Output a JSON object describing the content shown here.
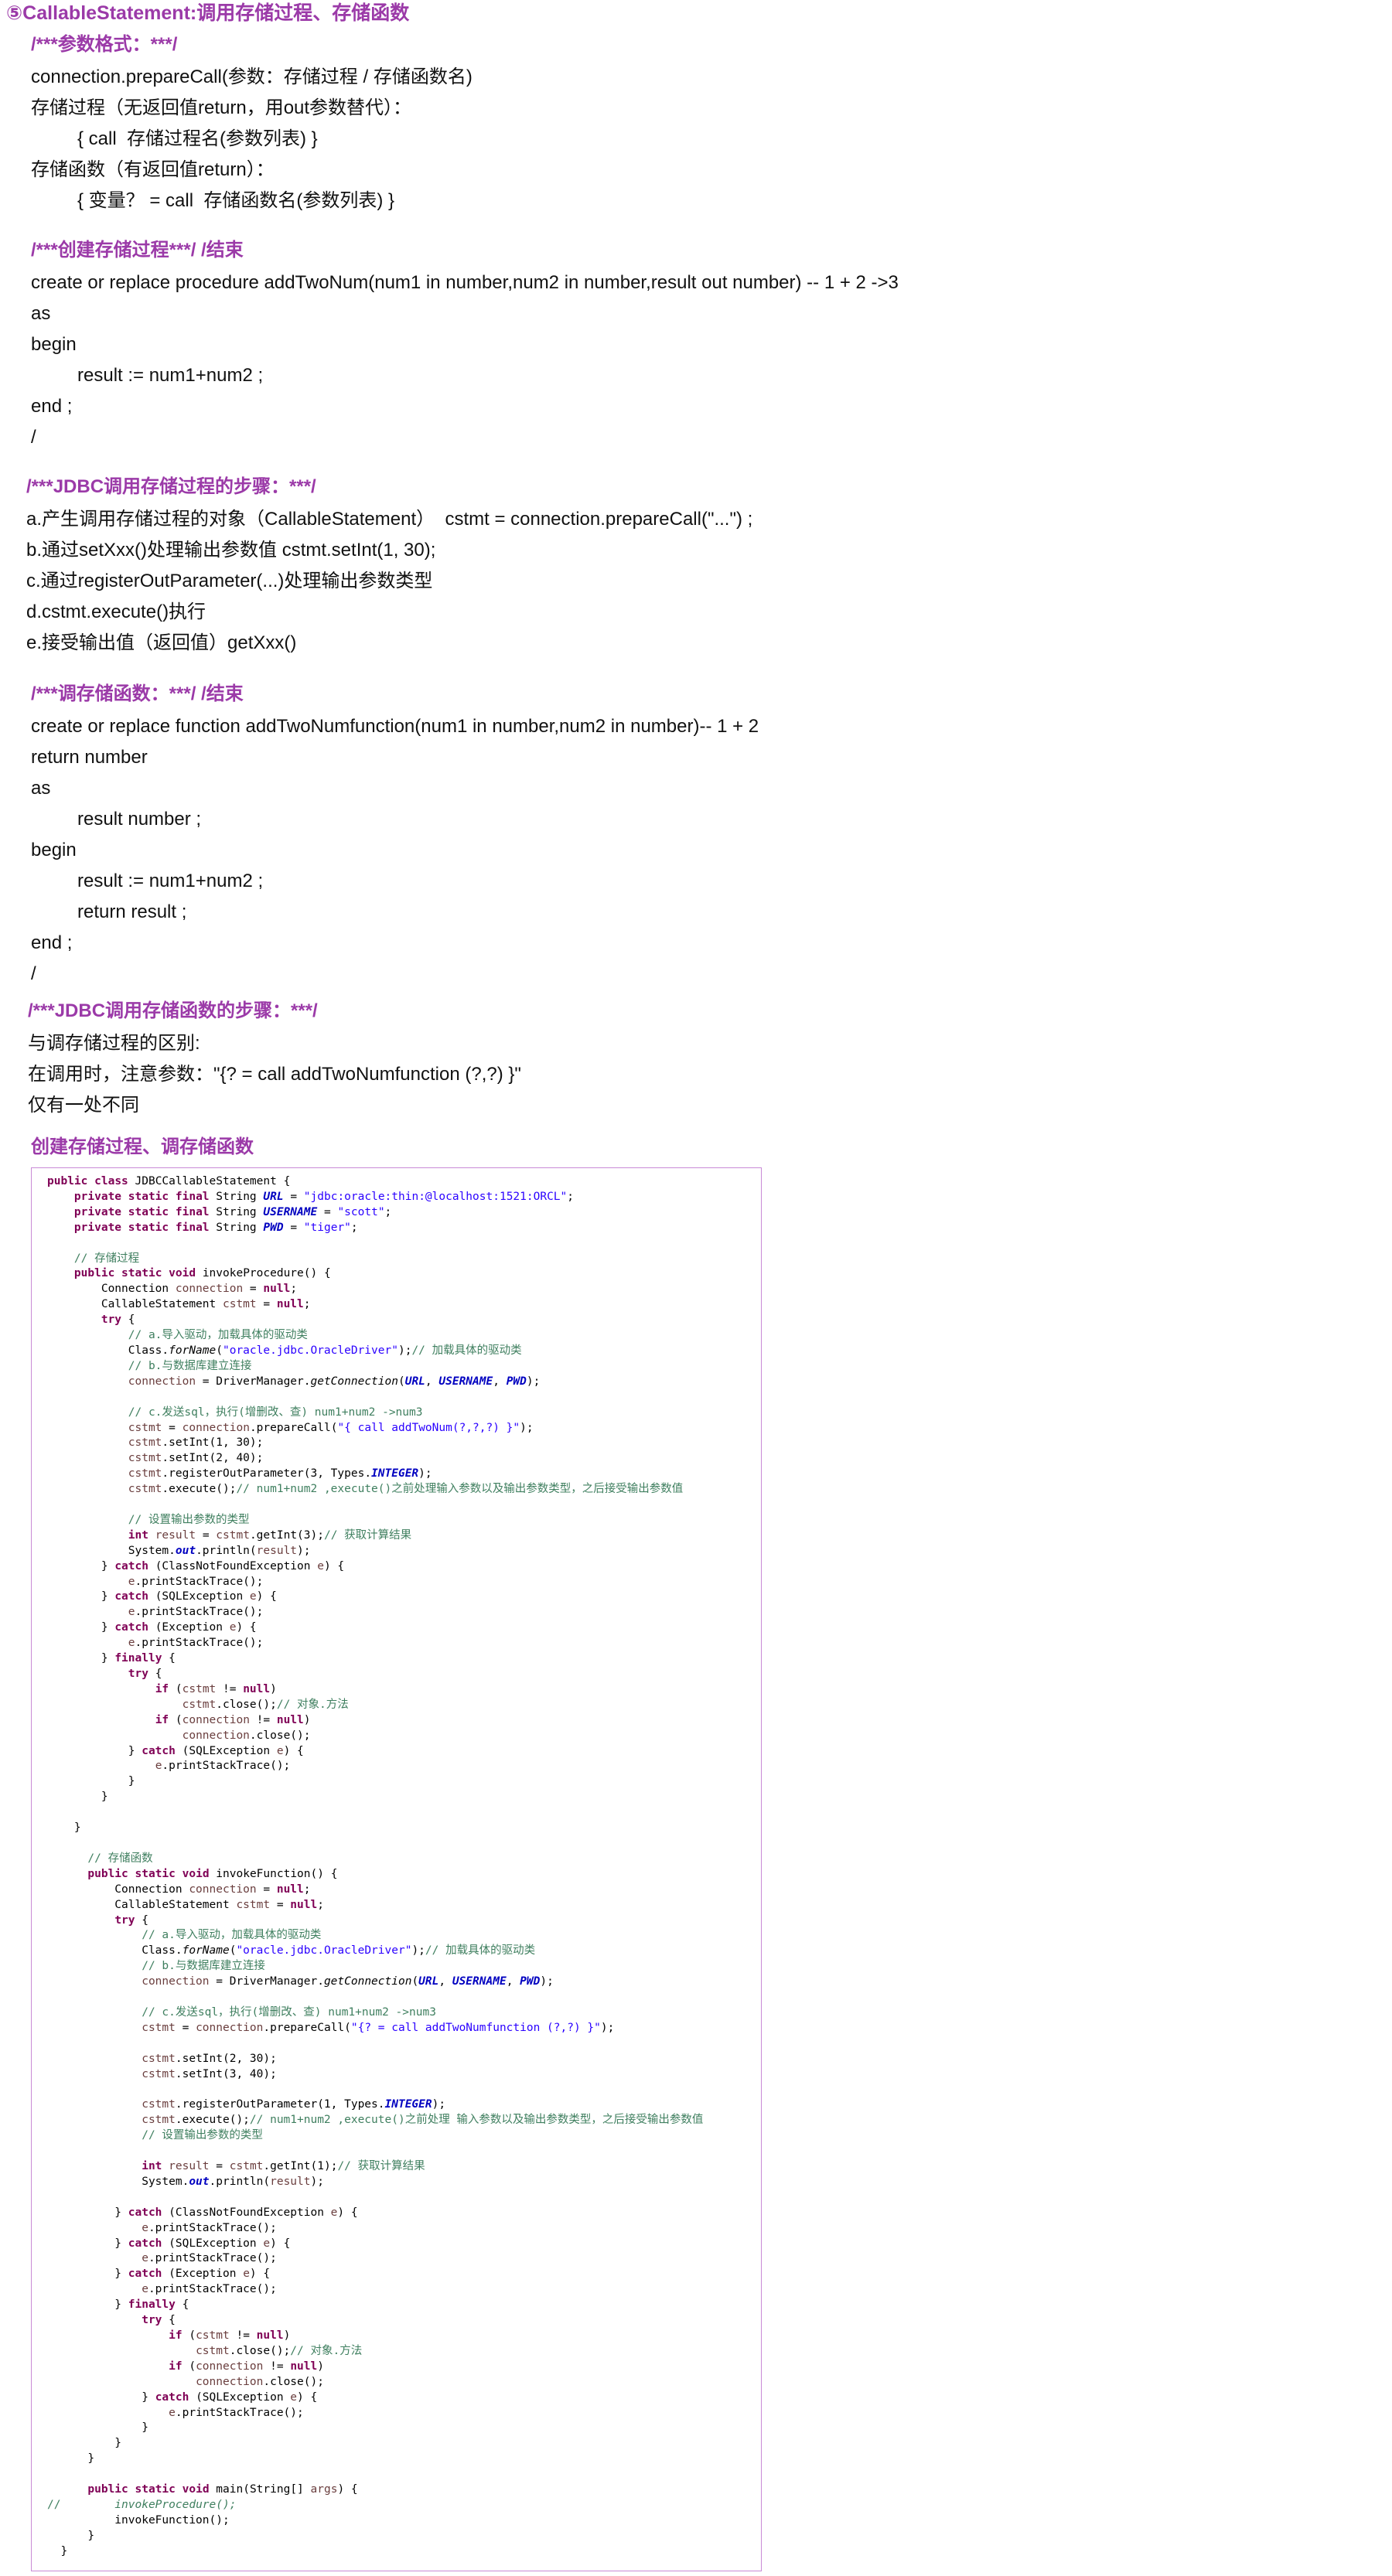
{
  "heading": "⑤CallableStatement:调用存储过程、存储函数",
  "format_section": {
    "title": "/***参数格式：***/",
    "lines": [
      {
        "text": "connection.prepareCall(参数：存储过程 / 存储函数名)",
        "indent": 0
      },
      {
        "text": "存储过程（无返回值return，用out参数替代）：",
        "indent": 0
      },
      {
        "text": "{ call  存储过程名(参数列表) }",
        "indent": 1
      },
      {
        "text": "存储函数（有返回值return）：",
        "indent": 0
      },
      {
        "text": "{ 变量？ = call  存储函数名(参数列表) }",
        "indent": 1
      }
    ]
  },
  "create_proc_section": {
    "title": "/***创建存储过程***/      /结束",
    "lines": [
      {
        "text": "create or replace procedure addTwoNum(num1 in number,num2 in number,result out number) -- 1 + 2 ->3",
        "indent": 0
      },
      {
        "text": "as",
        "indent": 0
      },
      {
        "text": "begin",
        "indent": 0
      },
      {
        "text": "result := num1+num2 ;",
        "indent": 1
      },
      {
        "text": "end ;",
        "indent": 0
      },
      {
        "text": "/",
        "indent": 0
      }
    ]
  },
  "jdbc_proc_section": {
    "title": "/***JDBC调用存储过程的步骤：***/",
    "lines": [
      {
        "text": "a.产生调用存储过程的对象（CallableStatement）  cstmt = connection.prepareCall(\"...\") ;",
        "indent": 0
      },
      {
        "text": "b.通过setXxx()处理输出参数值 cstmt.setInt(1, 30);",
        "indent": 0
      },
      {
        "text": "c.通过registerOutParameter(...)处理输出参数类型",
        "indent": 0
      },
      {
        "text": "d.cstmt.execute()执行",
        "indent": 0
      },
      {
        "text": "e.接受输出值（返回值）getXxx()",
        "indent": 0
      }
    ]
  },
  "func_section": {
    "title": "/***调存储函数：***/       /结束",
    "lines": [
      {
        "text": "create or replace function addTwoNumfunction(num1 in number,num2 in number)-- 1 + 2",
        "indent": 0
      },
      {
        "text": "return number",
        "indent": 0
      },
      {
        "text": "as",
        "indent": 0
      },
      {
        "text": "result number ;",
        "indent": 1
      },
      {
        "text": "begin",
        "indent": 0
      },
      {
        "text": "result := num1+num2 ;",
        "indent": 1
      },
      {
        "text": "return result ;",
        "indent": 1
      },
      {
        "text": "end ;",
        "indent": 0
      },
      {
        "text": "/",
        "indent": 0
      }
    ]
  },
  "jdbc_func_section": {
    "title": "/***JDBC调用存储函数的步骤：***/",
    "lines": [
      {
        "text": "与调存储过程的区别:",
        "indent": 0
      },
      {
        "text": "在调用时，注意参数：\"{? = call addTwoNumfunction (?,?) }\"",
        "indent": 0
      },
      {
        "text": "仅有一处不同",
        "indent": 0
      }
    ]
  },
  "code_section": {
    "title": "创建存储过程、调存储函数",
    "code_lines": [
      "public class JDBCCallableStatement {",
      "    private static final String URL = \"jdbc:oracle:thin:@localhost:1521:ORCL\";",
      "    private static final String USERNAME = \"scott\";",
      "    private static final String PWD = \"tiger\";",
      "",
      "    // 存储过程",
      "    public static void invokeProcedure() {",
      "        Connection connection = null;",
      "        CallableStatement cstmt = null;",
      "        try {",
      "            // a.导入驱动，加载具体的驱动类",
      "            Class.forName(\"oracle.jdbc.OracleDriver\");// 加载具体的驱动类",
      "            // b.与数据库建立连接",
      "            connection = DriverManager.getConnection(URL, USERNAME, PWD);",
      "",
      "            // c.发送sql，执行(增删改、查) num1+num2 ->num3",
      "            cstmt = connection.prepareCall(\"{ call addTwoNum(?,?,?) }\");",
      "            cstmt.setInt(1, 30);",
      "            cstmt.setInt(2, 40);",
      "            cstmt.registerOutParameter(3, Types.INTEGER);",
      "            cstmt.execute();// num1+num2 ,execute()之前处理输入参数以及输出参数类型，之后接受输出参数值",
      "",
      "            // 设置输出参数的类型",
      "            int result = cstmt.getInt(3);// 获取计算结果",
      "            System.out.println(result);",
      "        } catch (ClassNotFoundException e) {",
      "            e.printStackTrace();",
      "        } catch (SQLException e) {",
      "            e.printStackTrace();",
      "        } catch (Exception e) {",
      "            e.printStackTrace();",
      "        } finally {",
      "            try {",
      "                if (cstmt != null)",
      "                    cstmt.close();// 对象.方法",
      "                if (connection != null)",
      "                    connection.close();",
      "            } catch (SQLException e) {",
      "                e.printStackTrace();",
      "            }",
      "        }",
      "",
      "    }",
      "",
      "      // 存储函数",
      "      public static void invokeFunction() {",
      "          Connection connection = null;",
      "          CallableStatement cstmt = null;",
      "          try {",
      "              // a.导入驱动，加载具体的驱动类",
      "              Class.forName(\"oracle.jdbc.OracleDriver\");// 加载具体的驱动类",
      "              // b.与数据库建立连接",
      "              connection = DriverManager.getConnection(URL, USERNAME, PWD);",
      "",
      "              // c.发送sql，执行(增删改、查) num1+num2 ->num3",
      "              cstmt = connection.prepareCall(\"{? = call addTwoNumfunction (?,?) }\");",
      "",
      "              cstmt.setInt(2, 30);",
      "              cstmt.setInt(3, 40);",
      "",
      "              cstmt.registerOutParameter(1, Types.INTEGER);",
      "              cstmt.execute();// num1+num2 ,execute()之前处理 输入参数以及输出参数类型，之后接受输出参数值",
      "              // 设置输出参数的类型",
      "",
      "              int result = cstmt.getInt(1);// 获取计算结果",
      "              System.out.println(result);",
      "",
      "          } catch (ClassNotFoundException e) {",
      "              e.printStackTrace();",
      "          } catch (SQLException e) {",
      "              e.printStackTrace();",
      "          } catch (Exception e) {",
      "              e.printStackTrace();",
      "          } finally {",
      "              try {",
      "                  if (cstmt != null)",
      "                      cstmt.close();// 对象.方法",
      "                  if (connection != null)",
      "                      connection.close();",
      "              } catch (SQLException e) {",
      "                  e.printStackTrace();",
      "              }",
      "          }",
      "      }",
      "",
      "      public static void main(String[] args) {",
      "//        invokeProcedure();",
      "          invokeFunction();",
      "      }",
      "  }"
    ]
  },
  "colors": {
    "heading": "#9b3aa8",
    "keyword": "#7f0055",
    "comment": "#3f7f5f",
    "string": "#2a00ff",
    "field": "#0000c0",
    "var": "#6a3e3e",
    "box_border": "#c98ad6"
  }
}
